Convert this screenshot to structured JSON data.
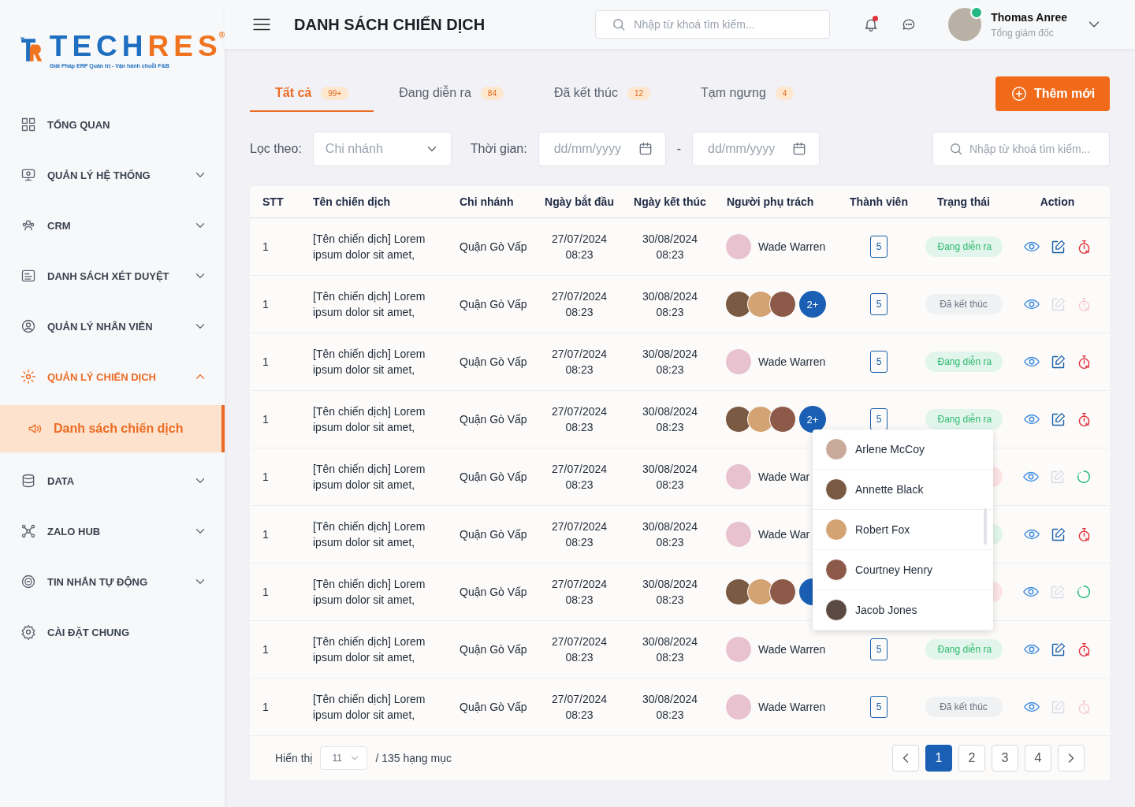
{
  "sidebar": {
    "logo": {
      "wordmark_left": "TECH",
      "wordmark_right": "RES",
      "registered": "®",
      "tagline": "Giải Pháp ERP Quản trị - Vận hành chuỗi F&B"
    },
    "items": [
      {
        "kind": "link",
        "label": "TỔNG QUAN",
        "selected": false
      },
      {
        "kind": "group",
        "label": "QUẢN LÝ HỆ THỐNG",
        "selected": false,
        "expanded": false
      },
      {
        "kind": "group",
        "label": "CRM",
        "selected": false,
        "expanded": false
      },
      {
        "kind": "group",
        "label": "DANH SÁCH XÉT DUYỆT",
        "selected": false,
        "expanded": false
      },
      {
        "kind": "group",
        "label": "QUẢN LÝ NHÂN VIÊN",
        "selected": false,
        "expanded": false
      },
      {
        "kind": "group",
        "label": "QUẢN LÝ CHIẾN DỊCH",
        "selected": true,
        "expanded": true,
        "children": [
          {
            "label": "Danh sách chiến dịch",
            "selected": true
          }
        ]
      },
      {
        "kind": "group",
        "label": "DATA",
        "selected": false,
        "expanded": false
      },
      {
        "kind": "group",
        "label": "ZALO HUB",
        "selected": false,
        "expanded": false
      },
      {
        "kind": "group",
        "label": "TIN NHẮN TỰ ĐỘNG",
        "selected": false,
        "expanded": false
      },
      {
        "kind": "link",
        "label": "CÀI ĐẶT CHUNG",
        "selected": false
      }
    ]
  },
  "header": {
    "title": "DANH SÁCH CHIẾN DỊCH",
    "search": {
      "placeholder": "Nhập từ khoá tìm kiếm..."
    },
    "notifications": {
      "unread": true
    },
    "user": {
      "name": "Thomas Anree",
      "role": "Tổng giám đốc",
      "online": true
    }
  },
  "tabs": [
    {
      "label": "Tất cả",
      "count": "99+",
      "selected": true
    },
    {
      "label": "Đang diễn ra",
      "count": "84",
      "selected": false
    },
    {
      "label": "Đã kết thúc",
      "count": "12",
      "selected": false
    },
    {
      "label": "Tạm ngưng",
      "count": "4",
      "selected": false
    }
  ],
  "add_button": "Thêm mới",
  "filters": {
    "label": "Lọc theo:",
    "branch": {
      "placeholder": "Chi nhánh"
    },
    "time_label": "Thời gian:",
    "from": {
      "placeholder": "dd/mm/yyyy"
    },
    "separator": "-",
    "to": {
      "placeholder": "dd/mm/yyyy"
    },
    "search": {
      "placeholder": "Nhập từ khoá tìm kiếm..."
    }
  },
  "table": {
    "columns": [
      "STT",
      "Tên chiến dịch",
      "Chi nhánh",
      "Ngày bắt đầu",
      "Ngày kết thúc",
      "Người phụ trách",
      "Thành viên",
      "Trạng thái",
      "Action"
    ],
    "rows": [
      {
        "stt": "1",
        "name": "[Tên chiến dịch] Lorem ipsum dolor sit amet,",
        "branch": "Quận Gò Vấp",
        "start_date": "27/07/2024",
        "start_time": "08:23",
        "end_date": "30/08/2024",
        "end_time": "08:23",
        "owner": {
          "kind": "single",
          "name": "Wade Warren"
        },
        "members": "5",
        "status": {
          "kind": "active",
          "label": "Đang diễn ra"
        }
      },
      {
        "stt": "1",
        "name": "[Tên chiến dịch] Lorem ipsum dolor sit amet,",
        "branch": "Quận Gò Vấp",
        "start_date": "27/07/2024",
        "start_time": "08:23",
        "end_date": "30/08/2024",
        "end_time": "08:23",
        "owner": {
          "kind": "group",
          "more": "2+"
        },
        "members": "5",
        "status": {
          "kind": "ended",
          "label": "Đã kết thúc"
        }
      },
      {
        "stt": "1",
        "name": "[Tên chiến dịch] Lorem ipsum dolor sit amet,",
        "branch": "Quận Gò Vấp",
        "start_date": "27/07/2024",
        "start_time": "08:23",
        "end_date": "30/08/2024",
        "end_time": "08:23",
        "owner": {
          "kind": "single",
          "name": "Wade Warren"
        },
        "members": "5",
        "status": {
          "kind": "active",
          "label": "Đang diễn ra"
        }
      },
      {
        "stt": "1",
        "name": "[Tên chiến dịch] Lorem ipsum dolor sit amet,",
        "branch": "Quận Gò Vấp",
        "start_date": "27/07/2024",
        "start_time": "08:23",
        "end_date": "30/08/2024",
        "end_time": "08:23",
        "owner": {
          "kind": "group",
          "more": "2+"
        },
        "members": "5",
        "status": {
          "kind": "active",
          "label": "Đang diễn ra"
        }
      },
      {
        "stt": "1",
        "name": "[Tên chiến dịch] Lorem ipsum dolor sit amet,",
        "branch": "Quận Gò Vấp",
        "start_date": "27/07/2024",
        "start_time": "08:23",
        "end_date": "30/08/2024",
        "end_time": "08:23",
        "owner": {
          "kind": "single",
          "name": "Wade War"
        },
        "status": {
          "kind": "paused"
        }
      },
      {
        "stt": "1",
        "name": "[Tên chiến dịch] Lorem ipsum dolor sit amet,",
        "branch": "Quận Gò Vấp",
        "start_date": "27/07/2024",
        "start_time": "08:23",
        "end_date": "30/08/2024",
        "end_time": "08:23",
        "owner": {
          "kind": "single",
          "name": "Wade War"
        },
        "status": {
          "kind": "active"
        }
      },
      {
        "stt": "1",
        "name": "[Tên chiến dịch] Lorem ipsum dolor sit amet,",
        "branch": "Quận Gò Vấp",
        "start_date": "27/07/2024",
        "start_time": "08:23",
        "end_date": "30/08/2024",
        "end_time": "08:23",
        "owner": {
          "kind": "group"
        },
        "status": {
          "kind": "paused"
        }
      },
      {
        "stt": "1",
        "name": "[Tên chiến dịch] Lorem ipsum dolor sit amet,",
        "branch": "Quận Gò Vấp",
        "start_date": "27/07/2024",
        "start_time": "08:23",
        "end_date": "30/08/2024",
        "end_time": "08:23",
        "owner": {
          "kind": "single",
          "name": "Wade Warren"
        },
        "members": "5",
        "status": {
          "kind": "active",
          "label": "Đang diễn ra"
        }
      },
      {
        "stt": "1",
        "name": "[Tên chiến dịch] Lorem ipsum dolor sit amet,",
        "branch": "Quận Gò Vấp",
        "start_date": "27/07/2024",
        "start_time": "08:23",
        "end_date": "30/08/2024",
        "end_time": "08:23",
        "owner": {
          "kind": "single",
          "name": "Wade Warren"
        },
        "members": "5",
        "status": {
          "kind": "ended",
          "label": "Đã kết thúc"
        }
      }
    ]
  },
  "member_popup": {
    "people": [
      "Arlene McCoy",
      "Annette Black",
      "Robert Fox",
      "Courtney Henry",
      "Jacob Jones"
    ]
  },
  "footer": {
    "show_label": "Hiển thị",
    "page_size": "11",
    "total": "/ 135 hạng mục",
    "pages": [
      {
        "label": "1",
        "selected": true
      },
      {
        "label": "2",
        "selected": false
      },
      {
        "label": "3",
        "selected": false
      },
      {
        "label": "4",
        "selected": false
      }
    ]
  }
}
